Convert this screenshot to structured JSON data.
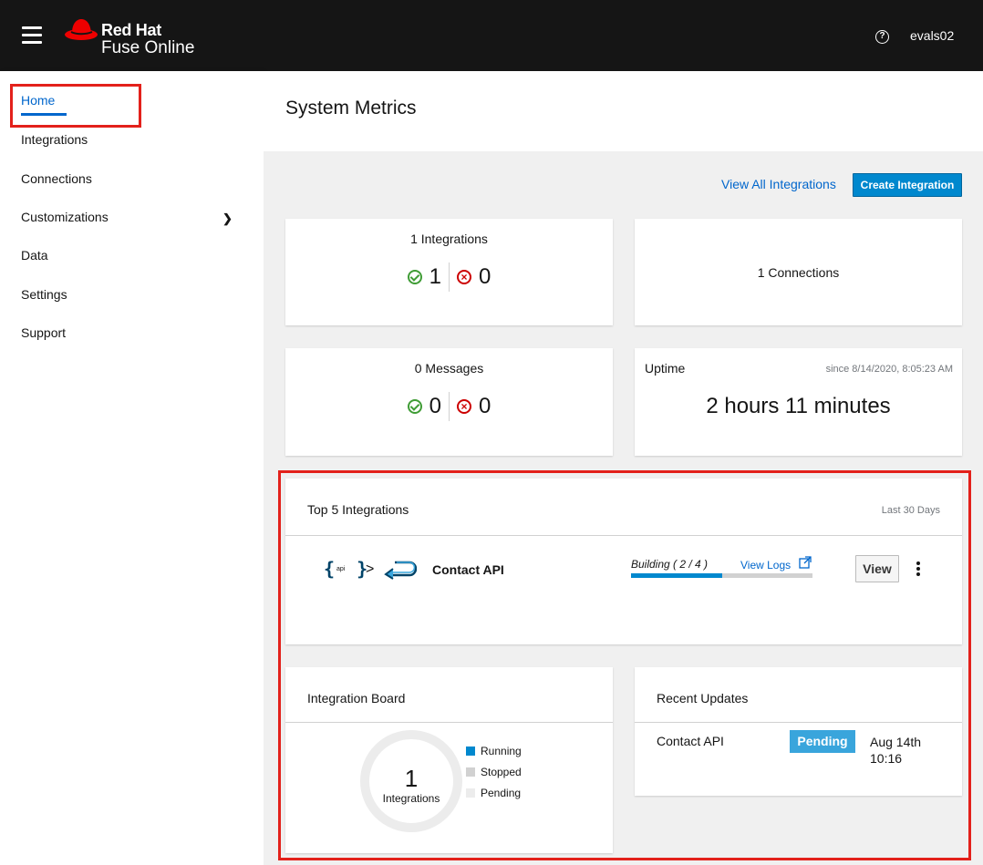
{
  "header": {
    "brand_name": "Red Hat",
    "brand_sub": "Fuse Online",
    "help_icon": "help-icon",
    "user": "evals02",
    "colors": {
      "bar": "#151515",
      "accent": "#ee0000"
    }
  },
  "sidebar": {
    "items": [
      {
        "label": "Home",
        "active": true
      },
      {
        "label": "Integrations"
      },
      {
        "label": "Connections"
      },
      {
        "label": "Customizations",
        "icon": "chevron-right-icon"
      },
      {
        "label": "Data"
      },
      {
        "label": "Settings"
      },
      {
        "label": "Support"
      }
    ]
  },
  "main": {
    "title": "System Metrics",
    "actions": {
      "view_all": "View All Integrations",
      "create": "Create Integration"
    },
    "integrations_card": {
      "title": "1 Integrations",
      "ok": "1",
      "error": "0"
    },
    "connections_card": {
      "title": "1 Connections"
    },
    "messages_card": {
      "title": "0 Messages",
      "ok": "0",
      "error": "0"
    },
    "uptime_card": {
      "label": "Uptime",
      "since": "since 8/14/2020, 8:05:23 AM",
      "value": "2 hours 11 minutes"
    },
    "top5": {
      "title": "Top 5 Integrations",
      "range": "Last 30 Days",
      "item": {
        "api_icon": "api-icon",
        "api_text": "api",
        "arrow": ">",
        "name": "Contact API",
        "status": "Building ( 2 / 4 )",
        "progress": 0.5,
        "view_logs": "View Logs",
        "view_button": "View"
      }
    },
    "board": {
      "title": "Integration Board",
      "total": "1",
      "total_label": "Integrations",
      "legend": [
        {
          "label": "Running",
          "color": "#0088ce"
        },
        {
          "label": "Stopped",
          "color": "#d1d1d1"
        },
        {
          "label": "Pending",
          "color": "#ececec"
        }
      ]
    },
    "updates": {
      "title": "Recent Updates",
      "item": {
        "name": "Contact API",
        "status": "Pending",
        "date_line1": "Aug 14th",
        "date_line2": "10:16"
      }
    }
  }
}
